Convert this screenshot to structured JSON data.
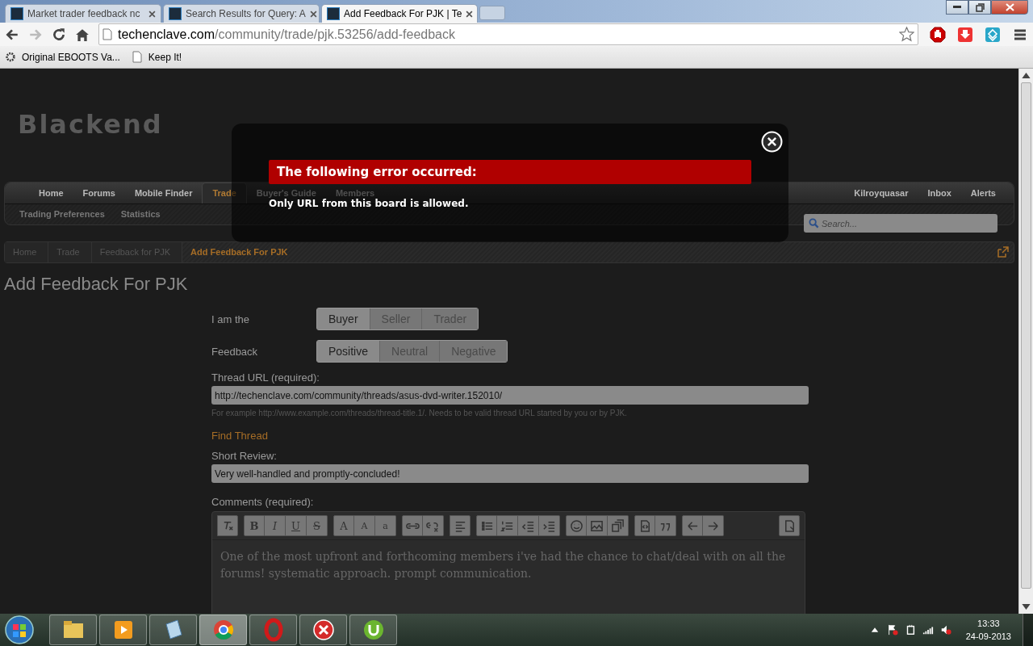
{
  "browser": {
    "tabs": [
      {
        "title": "Market trader feedback nc",
        "selected": false
      },
      {
        "title": "Search Results for Query: A",
        "selected": false
      },
      {
        "title": "Add Feedback For PJK | Te",
        "selected": true
      }
    ],
    "url": {
      "host": "techenclave.com",
      "path": "/community/trade/pjk.53256/add-feedback"
    },
    "bookmarks": [
      {
        "label": "Original EBOOTS Va...",
        "kind": "app"
      },
      {
        "label": "Keep It!",
        "kind": "page"
      }
    ]
  },
  "site": {
    "logo": "Blackend",
    "nav": {
      "tabs": [
        {
          "label": "Home",
          "selected": false
        },
        {
          "label": "Forums",
          "selected": false
        },
        {
          "label": "Mobile Finder",
          "selected": false
        },
        {
          "label": "Trade",
          "selected": true
        },
        {
          "label": "Buyer's Guide",
          "selected": false
        },
        {
          "label": "Members",
          "selected": false
        }
      ],
      "user_links": [
        "Kilroyquasar",
        "Inbox",
        "Alerts"
      ],
      "sub_links": [
        "Trading Preferences",
        "Statistics"
      ],
      "search": {
        "placeholder": "Search..."
      }
    },
    "breadcrumb": [
      {
        "label": "Home",
        "current": false
      },
      {
        "label": "Trade",
        "current": false
      },
      {
        "label": "Feedback for PJK",
        "current": false
      },
      {
        "label": "Add Feedback For PJK",
        "current": true
      }
    ],
    "page_title": "Add Feedback For PJK",
    "form": {
      "role": {
        "label": "I am the",
        "options": [
          {
            "label": "Buyer",
            "selected": true
          },
          {
            "label": "Seller",
            "selected": false
          },
          {
            "label": "Trader",
            "selected": false
          }
        ]
      },
      "feedback": {
        "label": "Feedback",
        "options": [
          {
            "label": "Positive",
            "selected": true
          },
          {
            "label": "Neutral",
            "selected": false
          },
          {
            "label": "Negative",
            "selected": false
          }
        ]
      },
      "thread_url": {
        "label": "Thread URL (required):",
        "value": "http://techenclave.com/community/threads/asus-dvd-writer.152010/",
        "hint": "For example http://www.example.com/threads/thread-title.1/. Needs to be valid thread URL started by you or by PJK."
      },
      "find_thread": "Find Thread",
      "short_review": {
        "label": "Short Review:",
        "value": "Very well-handled and promptly-concluded!"
      },
      "comments": {
        "label": "Comments (required):",
        "toolbar": [
          [
            {
              "kind": "clear-format"
            }
          ],
          [
            {
              "kind": "bold",
              "label": "B"
            },
            {
              "kind": "italic",
              "label": "I"
            },
            {
              "kind": "underline",
              "label": "U"
            },
            {
              "kind": "strike",
              "label": "S"
            }
          ],
          [
            {
              "kind": "font-color",
              "label": "A"
            },
            {
              "kind": "font-size",
              "label": "A"
            },
            {
              "kind": "font-family",
              "label": "a"
            }
          ],
          [
            {
              "kind": "link"
            },
            {
              "kind": "unlink"
            }
          ],
          [
            {
              "kind": "align"
            }
          ],
          [
            {
              "kind": "bullets"
            },
            {
              "kind": "numbers"
            },
            {
              "kind": "outdent"
            },
            {
              "kind": "indent"
            }
          ],
          [
            {
              "kind": "smiley"
            },
            {
              "kind": "image"
            },
            {
              "kind": "media"
            }
          ],
          [
            {
              "kind": "code"
            },
            {
              "kind": "quote"
            }
          ],
          [
            {
              "kind": "undo"
            },
            {
              "kind": "redo"
            }
          ]
        ],
        "text": "One of the most upfront and forthcoming members i've had the chance to chat/deal with on all the forums! systematic approach. prompt communication."
      }
    }
  },
  "dialog": {
    "heading": "The following error occurred:",
    "message": "Only URL from this board is allowed."
  },
  "taskbar": {
    "apps": [
      {
        "kind": "folder",
        "selected": false
      },
      {
        "kind": "media",
        "selected": false
      },
      {
        "kind": "notes",
        "selected": false
      },
      {
        "kind": "chrome",
        "selected": true
      },
      {
        "kind": "opera",
        "selected": false
      },
      {
        "kind": "error",
        "selected": false
      },
      {
        "kind": "torrent",
        "selected": false
      }
    ],
    "time": "13:33",
    "date": "24-09-2013"
  }
}
